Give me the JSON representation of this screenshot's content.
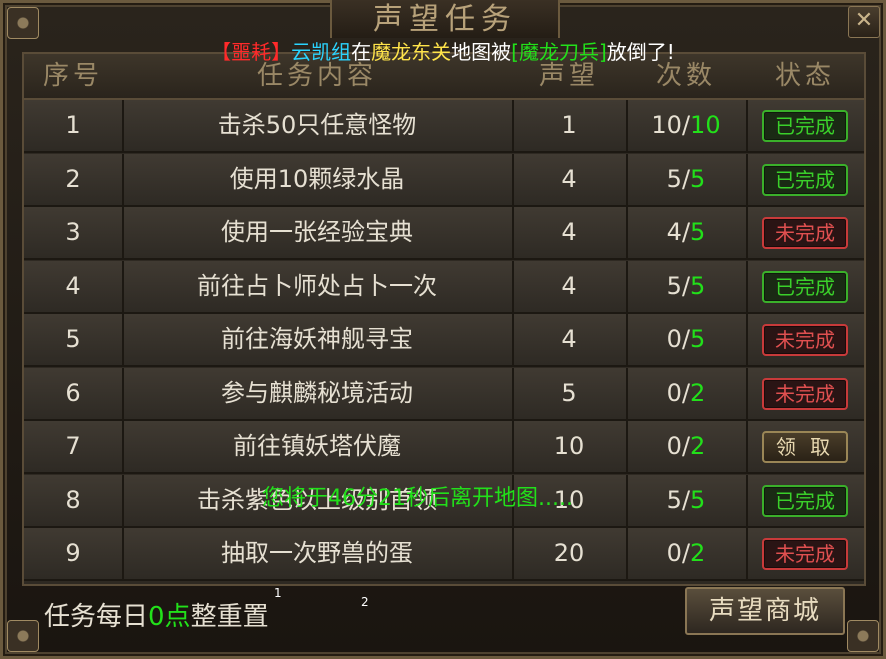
{
  "title": "声望任务",
  "close_label": "✕",
  "notice": {
    "part1": "【噩耗】",
    "part2": "云凯组",
    "part3": "在",
    "part4": "魔龙东关",
    "part5": "地图被",
    "part6": "[魔龙刀兵]",
    "part7": "放倒了!"
  },
  "headers": [
    "序号",
    "任务内容",
    "声望",
    "次数",
    "状态"
  ],
  "rows": [
    {
      "no": "1",
      "task": "击杀50只任意怪物",
      "rep": "1",
      "done": "10",
      "total": "10",
      "status": "已完成",
      "kind": "done"
    },
    {
      "no": "2",
      "task": "使用10颗绿水晶",
      "rep": "4",
      "done": "5",
      "total": "5",
      "status": "已完成",
      "kind": "done"
    },
    {
      "no": "3",
      "task": "使用一张经验宝典",
      "rep": "4",
      "done": "4",
      "total": "5",
      "status": "未完成",
      "kind": "undone"
    },
    {
      "no": "4",
      "task": "前往占卜师处占卜一次",
      "rep": "4",
      "done": "5",
      "total": "5",
      "status": "已完成",
      "kind": "done"
    },
    {
      "no": "5",
      "task": "前往海妖神舰寻宝",
      "rep": "4",
      "done": "0",
      "total": "5",
      "status": "未完成",
      "kind": "undone"
    },
    {
      "no": "6",
      "task": "参与麒麟秘境活动",
      "rep": "5",
      "done": "0",
      "total": "2",
      "status": "未完成",
      "kind": "undone"
    },
    {
      "no": "7",
      "task": "前往镇妖塔伏魔",
      "rep": "10",
      "done": "0",
      "total": "2",
      "status": "领 取",
      "kind": "claim"
    },
    {
      "no": "8",
      "task": "击杀紫色以上级别首领",
      "rep": "10",
      "done": "5",
      "total": "5",
      "status": "已完成",
      "kind": "done"
    },
    {
      "no": "9",
      "task": "抽取一次野兽的蛋",
      "rep": "20",
      "done": "0",
      "total": "2",
      "status": "未完成",
      "kind": "undone"
    }
  ],
  "float_message": "您将于46分21秒后离开地图.....",
  "footer": {
    "prefix": "任务每日",
    "highlight": "0点",
    "suffix": "整重置",
    "marker1": "1",
    "marker2": "2"
  },
  "shop_button": "声望商城",
  "colors": {
    "accent_green": "#22e01a",
    "status_red": "#e05050",
    "gold": "#b8a27a"
  }
}
